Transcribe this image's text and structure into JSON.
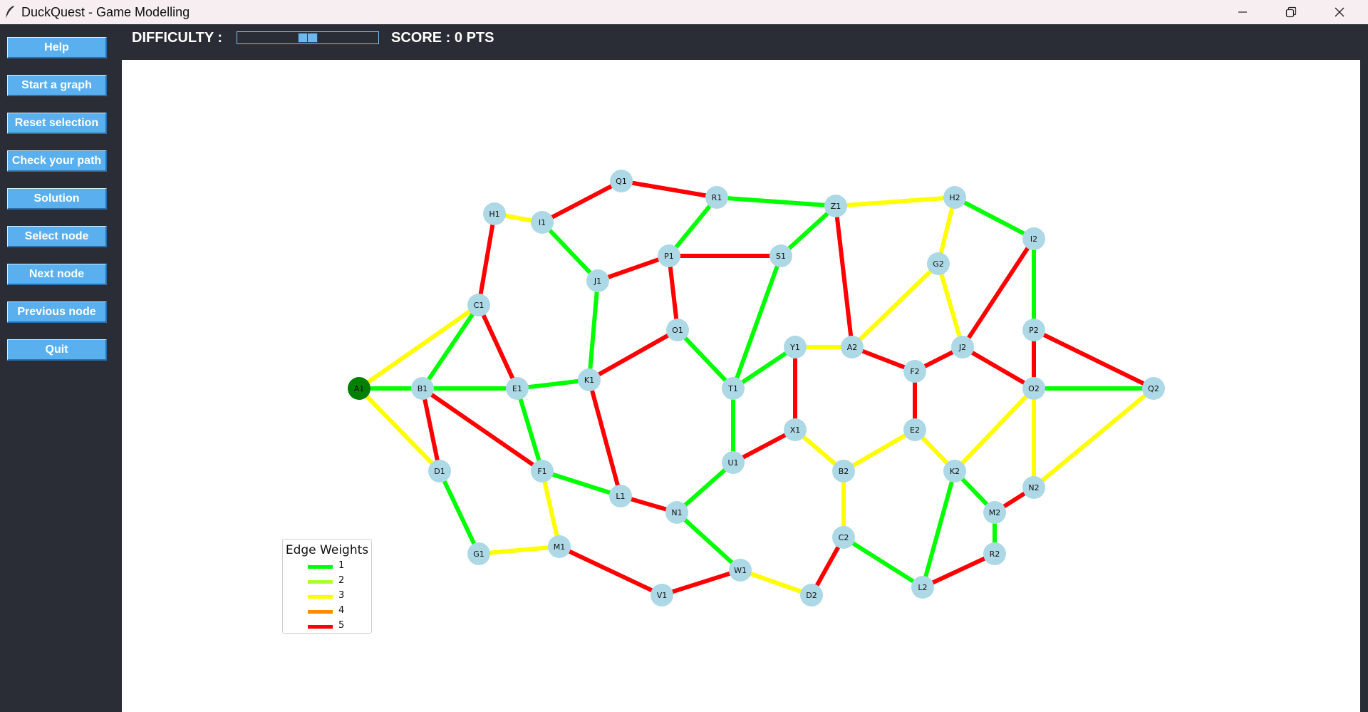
{
  "window": {
    "title": "DuckQuest - Game Modelling",
    "icons": [
      "feather-icon",
      "minimize-icon",
      "maximize-icon",
      "close-icon"
    ]
  },
  "sidebar": {
    "buttons": [
      {
        "label": "Help"
      },
      {
        "label": "Start a graph"
      },
      {
        "label": "Reset selection"
      },
      {
        "label": "Check your path"
      },
      {
        "label": "Solution"
      },
      {
        "label": "Select node"
      },
      {
        "label": "Next node"
      },
      {
        "label": "Previous node"
      },
      {
        "label": "Quit"
      }
    ]
  },
  "topbar": {
    "difficulty_label": "DIFFICULTY :",
    "difficulty_level": 0.5,
    "score_label": "SCORE : 0 PTS"
  },
  "legend": {
    "title": "Edge Weights",
    "items": [
      {
        "label": "1",
        "color": "#00ff00"
      },
      {
        "label": "2",
        "color": "#adff2f"
      },
      {
        "label": "3",
        "color": "#ffff00"
      },
      {
        "label": "4",
        "color": "#ff8c00"
      },
      {
        "label": "5",
        "color": "#ff0000"
      }
    ]
  },
  "graph": {
    "node_color": "#add8e6",
    "selected_color": "#008000",
    "selected_node": "A1",
    "nodes": [
      "A1",
      "B1",
      "C1",
      "D1",
      "E1",
      "F1",
      "G1",
      "H1",
      "I1",
      "J1",
      "K1",
      "L1",
      "M1",
      "N1",
      "O1",
      "P1",
      "Q1",
      "R1",
      "S1",
      "T1",
      "U1",
      "V1",
      "W1",
      "X1",
      "Y1",
      "Z1",
      "A2",
      "B2",
      "C2",
      "D2",
      "E2",
      "F2",
      "G2",
      "H2",
      "I2",
      "J2",
      "K2",
      "L2",
      "M2",
      "N2",
      "O2",
      "P2",
      "Q2",
      "R2"
    ],
    "edges": [
      [
        "A1",
        "B1",
        1
      ],
      [
        "A1",
        "C1",
        3
      ],
      [
        "A1",
        "D1",
        3
      ],
      [
        "B1",
        "C1",
        1
      ],
      [
        "B1",
        "E1",
        1
      ],
      [
        "B1",
        "D1",
        5
      ],
      [
        "B1",
        "F1",
        5
      ],
      [
        "C1",
        "H1",
        5
      ],
      [
        "C1",
        "E1",
        5
      ],
      [
        "D1",
        "G1",
        1
      ],
      [
        "E1",
        "K1",
        1
      ],
      [
        "E1",
        "F1",
        1
      ],
      [
        "F1",
        "L1",
        1
      ],
      [
        "F1",
        "M1",
        3
      ],
      [
        "G1",
        "M1",
        3
      ],
      [
        "H1",
        "I1",
        3
      ],
      [
        "I1",
        "Q1",
        5
      ],
      [
        "I1",
        "J1",
        1
      ],
      [
        "J1",
        "P1",
        5
      ],
      [
        "J1",
        "K1",
        1
      ],
      [
        "K1",
        "O1",
        5
      ],
      [
        "K1",
        "L1",
        5
      ],
      [
        "L1",
        "N1",
        5
      ],
      [
        "M1",
        "V1",
        5
      ],
      [
        "N1",
        "U1",
        1
      ],
      [
        "N1",
        "W1",
        1
      ],
      [
        "O1",
        "P1",
        5
      ],
      [
        "O1",
        "T1",
        1
      ],
      [
        "P1",
        "R1",
        1
      ],
      [
        "P1",
        "S1",
        5
      ],
      [
        "Q1",
        "R1",
        5
      ],
      [
        "R1",
        "Z1",
        1
      ],
      [
        "S1",
        "Z1",
        1
      ],
      [
        "S1",
        "T1",
        1
      ],
      [
        "T1",
        "Y1",
        1
      ],
      [
        "T1",
        "U1",
        1
      ],
      [
        "U1",
        "X1",
        5
      ],
      [
        "V1",
        "W1",
        5
      ],
      [
        "W1",
        "D2",
        3
      ],
      [
        "X1",
        "Y1",
        5
      ],
      [
        "X1",
        "B2",
        3
      ],
      [
        "Y1",
        "A2",
        3
      ],
      [
        "Z1",
        "H2",
        3
      ],
      [
        "Z1",
        "A2",
        5
      ],
      [
        "A2",
        "G2",
        3
      ],
      [
        "A2",
        "F2",
        5
      ],
      [
        "B2",
        "C2",
        3
      ],
      [
        "B2",
        "E2",
        3
      ],
      [
        "C2",
        "D2",
        5
      ],
      [
        "C2",
        "L2",
        1
      ],
      [
        "E2",
        "F2",
        5
      ],
      [
        "E2",
        "K2",
        3
      ],
      [
        "F2",
        "J2",
        5
      ],
      [
        "G2",
        "H2",
        3
      ],
      [
        "G2",
        "J2",
        3
      ],
      [
        "H2",
        "I2",
        1
      ],
      [
        "I2",
        "J2",
        5
      ],
      [
        "I2",
        "P2",
        1
      ],
      [
        "J2",
        "O2",
        5
      ],
      [
        "K2",
        "O2",
        3
      ],
      [
        "K2",
        "M2",
        1
      ],
      [
        "K2",
        "L2",
        1
      ],
      [
        "L2",
        "R2",
        5
      ],
      [
        "M2",
        "R2",
        1
      ],
      [
        "M2",
        "N2",
        5
      ],
      [
        "N2",
        "O2",
        3
      ],
      [
        "N2",
        "Q2",
        3
      ],
      [
        "O2",
        "P2",
        5
      ],
      [
        "O2",
        "Q2",
        1
      ],
      [
        "P2",
        "Q2",
        5
      ]
    ]
  }
}
